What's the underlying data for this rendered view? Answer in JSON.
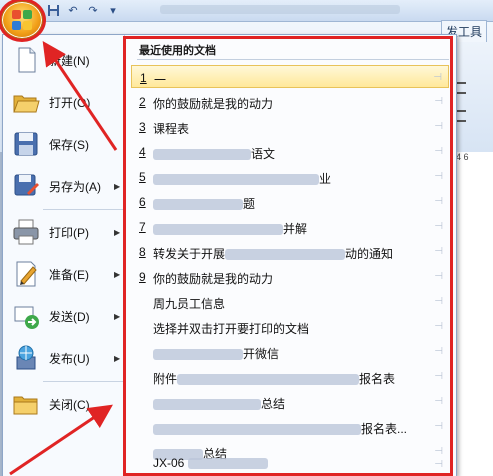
{
  "ribbon": {
    "tab_right": "发工具",
    "ruler_numbers": "4    6"
  },
  "quick_access": {
    "save_icon": "save-icon",
    "undo_icon": "undo-icon",
    "redo_icon": "redo-icon"
  },
  "menu": {
    "commands": [
      {
        "label": "新建(N)",
        "icon": "new-document-icon",
        "has_submenu": false
      },
      {
        "label": "打开(O)",
        "icon": "open-folder-icon",
        "has_submenu": false
      },
      {
        "label": "保存(S)",
        "icon": "save-icon",
        "has_submenu": false
      },
      {
        "label": "另存为(A)",
        "icon": "save-as-icon",
        "has_submenu": true
      },
      {
        "label": "打印(P)",
        "icon": "printer-icon",
        "has_submenu": true
      },
      {
        "label": "准备(E)",
        "icon": "prepare-icon",
        "has_submenu": true
      },
      {
        "label": "发送(D)",
        "icon": "send-icon",
        "has_submenu": true
      },
      {
        "label": "发布(U)",
        "icon": "publish-icon",
        "has_submenu": true
      },
      {
        "label": "关闭(C)",
        "icon": "close-folder-icon",
        "has_submenu": false
      }
    ],
    "recent": {
      "title": "最近使用的文档",
      "items": [
        {
          "num": "1",
          "text": "一"
        },
        {
          "num": "2",
          "text": "你的鼓励就是我的动力"
        },
        {
          "num": "3",
          "text": "课程表"
        },
        {
          "num": "4",
          "text": "语文"
        },
        {
          "num": "5",
          "text": "业"
        },
        {
          "num": "6",
          "text": "题"
        },
        {
          "num": "7",
          "text": "并解"
        },
        {
          "num": "8",
          "text": "转发关于开展",
          "text_tail": "动的通知"
        },
        {
          "num": "9",
          "text": "你的鼓励就是我的动力"
        },
        {
          "num": "",
          "text": "周九员工信息"
        },
        {
          "num": "",
          "text": "选择并双击打开要打印的文档"
        },
        {
          "num": "",
          "text": "开微信"
        },
        {
          "num": "",
          "text": "附件",
          "text_tail": "报名表"
        },
        {
          "num": "",
          "text": "总结"
        },
        {
          "num": "",
          "text": "",
          "text_tail": "报名表..."
        },
        {
          "num": "",
          "text": "总结"
        },
        {
          "num": "",
          "text": "JX-06"
        }
      ]
    }
  },
  "colors": {
    "highlight": "#e02424",
    "accent": "#f2a11a"
  }
}
